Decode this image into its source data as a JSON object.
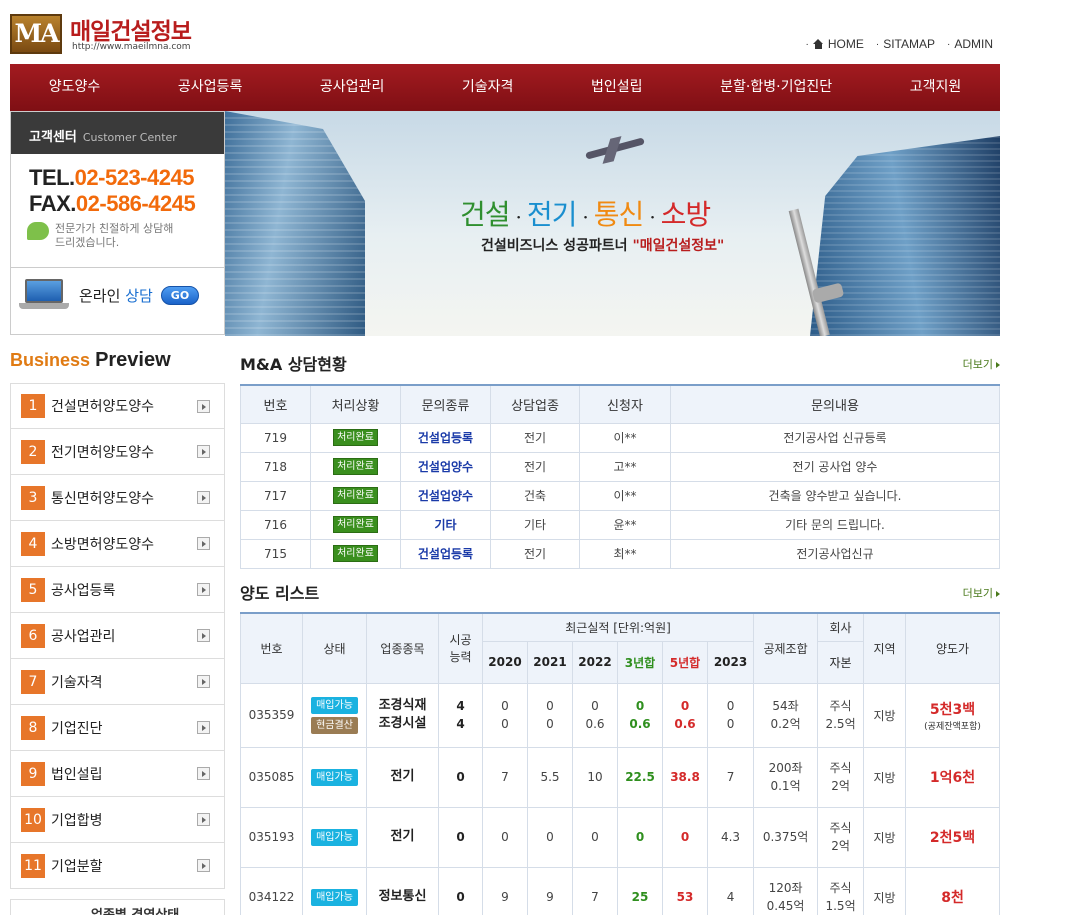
{
  "header": {
    "logo_mark": "MA",
    "site_name": "매일건설정보",
    "site_url": "http://www.maeilmna.com",
    "top_links": [
      "HOME",
      "SITAMAP",
      "ADMIN"
    ]
  },
  "nav": [
    "양도양수",
    "공사업등록",
    "공사업관리",
    "기술자격",
    "법인설립",
    "분할·합병·기업진단",
    "고객지원"
  ],
  "customer_center": {
    "title": "고객센터",
    "subtitle": "Customer Center",
    "tel_label": "TEL.",
    "tel": "02-523-4245",
    "fax_label": "FAX.",
    "fax": "02-586-4245",
    "note_line1": "전문가가 친절하게 상담해",
    "note_line2": "드리겠습니다.",
    "online_label": "온라인",
    "online_label2": "상담",
    "go": "GO"
  },
  "banner": {
    "words": [
      "건설",
      "전기",
      "통신",
      "소방"
    ],
    "word_colors": [
      "#2f8f2f",
      "#1a8fcf",
      "#f08a12",
      "#d42a2a"
    ],
    "tagline_prefix": "건설비즈니스 성공파트너 ",
    "tagline_brand": "\"매일건설정보\""
  },
  "business_preview": {
    "title_a": "Business",
    "title_b": "Preview",
    "items": [
      {
        "num": "1",
        "label": "건설면허양도양수"
      },
      {
        "num": "2",
        "label": "전기면허양도양수"
      },
      {
        "num": "3",
        "label": "통신면허양도양수"
      },
      {
        "num": "4",
        "label": "소방면허양도양수"
      },
      {
        "num": "5",
        "label": "공사업등록"
      },
      {
        "num": "6",
        "label": "공사업관리"
      },
      {
        "num": "7",
        "label": "기술자격"
      },
      {
        "num": "8",
        "label": "기업진단"
      },
      {
        "num": "9",
        "label": "법인설립"
      },
      {
        "num": "10",
        "label": "기업합병"
      },
      {
        "num": "11",
        "label": "기업분할"
      }
    ],
    "more_item": "업종별 경영상태"
  },
  "ma": {
    "title": "M&A 상담현황",
    "more": "더보기",
    "headers": [
      "번호",
      "처리상황",
      "문의종류",
      "상담업종",
      "신청자",
      "문의내용"
    ],
    "rows": [
      {
        "no": "719",
        "status": "처리완료",
        "type": "건설업등록",
        "field": "전기",
        "applicant": "이**",
        "content": "전기공사업 신규등록"
      },
      {
        "no": "718",
        "status": "처리완료",
        "type": "건설업양수",
        "field": "전기",
        "applicant": "고**",
        "content": "전기 공사업 양수"
      },
      {
        "no": "717",
        "status": "처리완료",
        "type": "건설업양수",
        "field": "건축",
        "applicant": "이**",
        "content": "건축을 양수받고 싶습니다."
      },
      {
        "no": "716",
        "status": "처리완료",
        "type": "기타",
        "field": "기타",
        "applicant": "윤**",
        "content": "기타 문의 드립니다."
      },
      {
        "no": "715",
        "status": "처리완료",
        "type": "건설업등록",
        "field": "전기",
        "applicant": "최**",
        "content": "전기공사업신규"
      }
    ]
  },
  "sale": {
    "title": "양도 리스트",
    "more": "더보기",
    "headers": {
      "no": "번호",
      "status": "상태",
      "kind": "업종종목",
      "capacity_1": "시공",
      "capacity_2": "능력",
      "perf": "최근실적 [단위:억원]",
      "union": "공제조합",
      "company_1": "회사",
      "company_2": "자본",
      "region": "지역",
      "price": "양도가",
      "years": [
        "2020",
        "2021",
        "2022",
        "3년합",
        "5년합",
        "2023"
      ]
    },
    "rows": [
      {
        "no": "035359",
        "badges": [
          "매입가능",
          "현금결산"
        ],
        "kinds": [
          "조경식재",
          "조경시설"
        ],
        "cap": [
          "4",
          "4"
        ],
        "y2020": [
          "0",
          "0"
        ],
        "y2021": [
          "0",
          "0"
        ],
        "y2022": [
          "0",
          "0.6"
        ],
        "sum3": [
          "0",
          "0.6"
        ],
        "sum5": [
          "0",
          "0.6"
        ],
        "y2023": [
          "0",
          "0"
        ],
        "union": [
          "54좌",
          "0.2억"
        ],
        "company": [
          "주식",
          "2.5억"
        ],
        "region": "지방",
        "price": "5천3백",
        "price_note": "(공제잔액포함)"
      },
      {
        "no": "035085",
        "badges": [
          "매입가능"
        ],
        "kinds": [
          "전기"
        ],
        "cap": [
          "0"
        ],
        "y2020": [
          "7"
        ],
        "y2021": [
          "5.5"
        ],
        "y2022": [
          "10"
        ],
        "sum3": [
          "22.5"
        ],
        "sum5": [
          "38.8"
        ],
        "y2023": [
          "7"
        ],
        "union": [
          "200좌",
          "0.1억"
        ],
        "company": [
          "주식",
          "2억"
        ],
        "region": "지방",
        "price": "1억6천",
        "price_note": ""
      },
      {
        "no": "035193",
        "badges": [
          "매입가능"
        ],
        "kinds": [
          "전기"
        ],
        "cap": [
          "0"
        ],
        "y2020": [
          "0"
        ],
        "y2021": [
          "0"
        ],
        "y2022": [
          "0"
        ],
        "sum3": [
          "0"
        ],
        "sum5": [
          "0"
        ],
        "y2023": [
          "4.3"
        ],
        "union": [
          "0.375억"
        ],
        "company": [
          "주식",
          "2억"
        ],
        "region": "지방",
        "price": "2천5백",
        "price_note": ""
      },
      {
        "no": "034122",
        "badges": [
          "매입가능"
        ],
        "kinds": [
          "정보통신"
        ],
        "cap": [
          "0"
        ],
        "y2020": [
          "9"
        ],
        "y2021": [
          "9"
        ],
        "y2022": [
          "7"
        ],
        "sum3": [
          "25"
        ],
        "sum5": [
          "53"
        ],
        "y2023": [
          "4"
        ],
        "union": [
          "120좌",
          "0.45억"
        ],
        "company": [
          "주식",
          "1.5억"
        ],
        "region": "지방",
        "price": "8천",
        "price_note": ""
      }
    ]
  }
}
